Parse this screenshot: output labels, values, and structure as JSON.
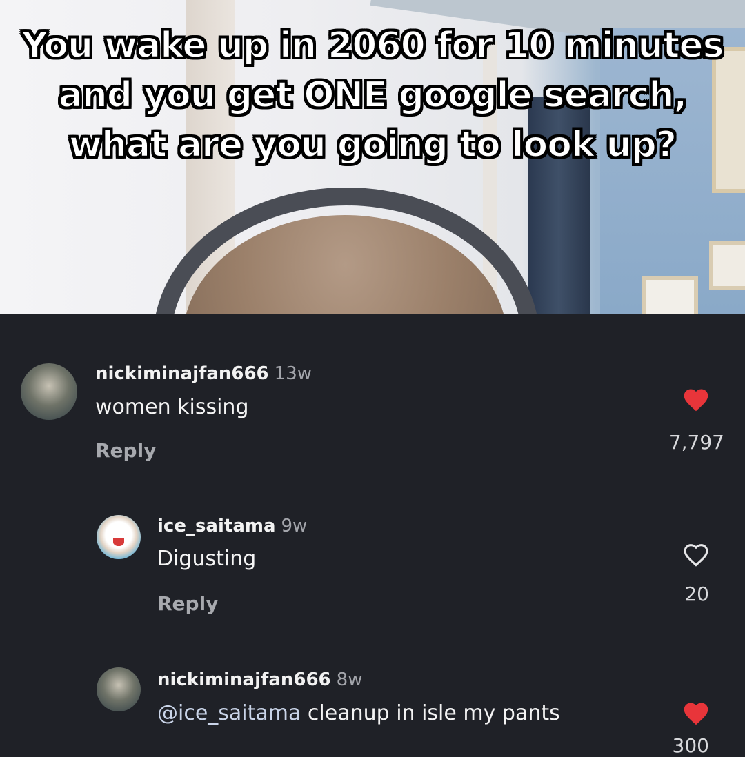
{
  "video": {
    "caption": "You wake up in 2060 for 10 minutes and you get ONE google search, what are you going to look up?"
  },
  "comments": [
    {
      "username": "nickiminajfan666",
      "time": "13w",
      "text": "women kissing",
      "reply_label": "Reply",
      "likes": "7,797",
      "liked": true
    },
    {
      "username": "ice_saitama",
      "time": "9w",
      "text": "Digusting",
      "reply_label": "Reply",
      "likes": "20",
      "liked": false
    },
    {
      "username": "nickiminajfan666",
      "time": "8w",
      "mention": "@ice_saitama",
      "text": " cleanup in isle my pants",
      "likes": "300",
      "liked": true
    }
  ],
  "colors": {
    "background": "#1f2127",
    "heart_liked": "#e8353a",
    "heart_outline": "#e6e6e8"
  },
  "icons": [
    "heart-filled-icon",
    "heart-outline-icon"
  ]
}
